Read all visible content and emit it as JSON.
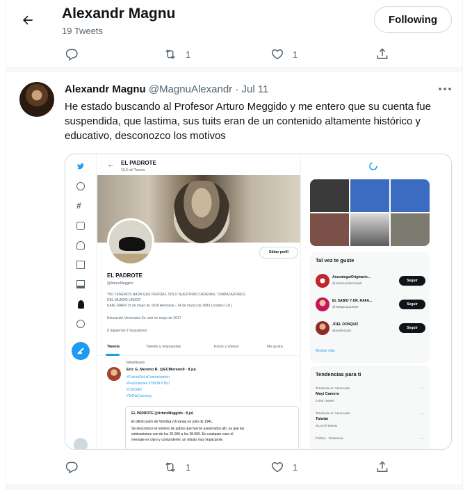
{
  "header": {
    "name": "Alexandr Magnu",
    "tweet_count": "19 Tweets",
    "follow_label": "Following"
  },
  "top_actions": {
    "retweets": "1",
    "likes": "1"
  },
  "tweet": {
    "name": "Alexandr Magnu",
    "handle_date": "@MagnuAlexandr · Jul 11",
    "text": "He estado buscando al Profesor Arturo Meggido y me entero que su cuenta fue suspendida, que lastima, sus tuits eran de un contenido altamente histórico y educativo, desconozco los motivos",
    "actions": {
      "retweets": "1",
      "likes": "1"
    }
  },
  "screenshot": {
    "title": "EL PADROTE",
    "subtitle": "10,3 mil Tweets",
    "edit_profile": "Editar perfil",
    "profile_name": "EL PADROTE",
    "profile_handle": "@ArturoMeggido",
    "bio_1": "\"NO TENEMOS NADA QUE PERDER, SÓLO NUESTRAS CADENAS. TRABAJADORES",
    "bio_2": "DEL MUNDO UNIOS\"",
    "bio_3": "KARL MARX (5 de mayo de 1818 Alemania - 14 de marzo de 1883 Londres U.K.)",
    "meta": "Educación   Venezuela   Se unió en mayo de 2017",
    "follow_stats": "8 Siguiendo    9 Seguidores",
    "tabs": [
      "Tweets",
      "Tweets y respuestas",
      "Fotos y videos",
      "Me gusta"
    ],
    "retweeted": "Retwitteado",
    "rt_author": "Eric G. Moreno R. @ECMoreno9 · 8 jul.",
    "rt_line1": "#FuerzaDeLaComunicación",
    "rt_line2": "#FelizViernes #TRON #TioJ",
    "rt_line3": "#CIUDAD",
    "rt_line4": "#TeDisCoinvnoy",
    "quote_author": "EL PADROTE @ArturoMeggido · 8 jul.",
    "quote_1": "El último judío de Vinnitsa (Ucrania) en julio de 1941.",
    "quote_2": "Se desconoce el número de judíos que fueron asesinados allí, ya que las",
    "quote_3": "estimaciones van de los 20.000 a los 28.000. En cualquier caso el",
    "quote_4": "mensaje es claro y contundente, un tributo muy impactante.",
    "suggest_title": "Tal vez te guste",
    "suggestions": [
      {
        "name": "AnzoateguiOriginario...",
        "handle": "@JoseCondorcamp6",
        "btn": "Seguir"
      },
      {
        "name": "EL SABIO Y DR. RAFA...",
        "handle": "@Rafajsoque2020",
        "btn": "Seguir"
      },
      {
        "name": "JOEL DONQUIZ",
        "handle": "@joeldonquiz",
        "btn": "Seguir"
      }
    ],
    "show_more": "Mostrar más",
    "trends_title": "Tendencias para ti",
    "trends": [
      {
        "ctx": "Tendencia en Venezuela",
        "name": "Mayi Camero",
        "count": "3.065 Tweets"
      },
      {
        "ctx": "Tendencia en Venezuela",
        "name": "Taiwán",
        "count": "30,3 mil Tweets"
      },
      {
        "ctx": "Política · Tendencia",
        "name": "",
        "count": ""
      }
    ]
  },
  "colors": {
    "accent": "#1d9bf0",
    "text": "#0f1419",
    "muted": "#536471"
  }
}
